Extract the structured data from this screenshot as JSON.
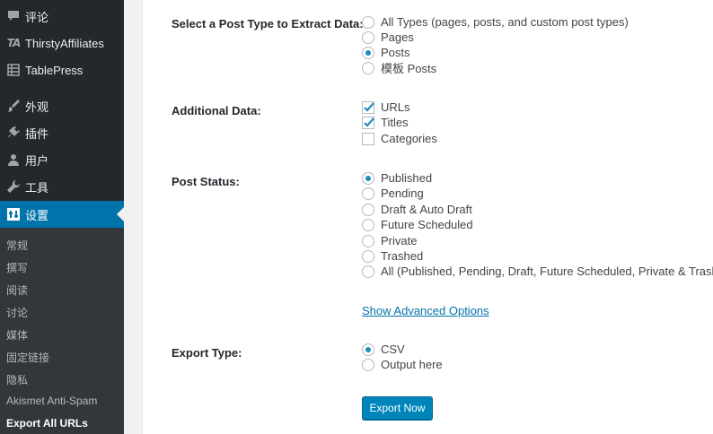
{
  "sidebar": {
    "items": [
      {
        "label": "评论",
        "icon": "comment-icon"
      },
      {
        "label": "ThirstyAffiliates",
        "icon": "thirstyaffiliates-logo-icon",
        "logo_text": "TA"
      },
      {
        "label": "TablePress",
        "icon": "table-icon"
      },
      {
        "label": "外观",
        "icon": "paintbrush-icon"
      },
      {
        "label": "插件",
        "icon": "plugin-icon"
      },
      {
        "label": "用户",
        "icon": "user-icon"
      },
      {
        "label": "工具",
        "icon": "wrench-icon"
      },
      {
        "label": "设置",
        "icon": "settings-icon",
        "active": true
      }
    ],
    "submenu": [
      {
        "label": "常规"
      },
      {
        "label": "撰写"
      },
      {
        "label": "阅读"
      },
      {
        "label": "讨论"
      },
      {
        "label": "媒体"
      },
      {
        "label": "固定链接"
      },
      {
        "label": "隐私"
      },
      {
        "label": "Akismet Anti-Spam"
      },
      {
        "label": "Export All URLs",
        "current": true
      }
    ]
  },
  "form": {
    "post_type": {
      "label": "Select a Post Type to Extract Data:",
      "options": [
        "All Types (pages, posts, and custom post types)",
        "Pages",
        "Posts",
        "模板 Posts"
      ],
      "selected": "Posts"
    },
    "additional_data": {
      "label": "Additional Data:",
      "options": [
        "URLs",
        "Titles",
        "Categories"
      ],
      "checked": [
        "URLs",
        "Titles"
      ]
    },
    "post_status": {
      "label": "Post Status:",
      "options": [
        "Published",
        "Pending",
        "Draft & Auto Draft",
        "Future Scheduled",
        "Private",
        "Trashed",
        "All (Published, Pending, Draft, Future Scheduled, Private & Trash)"
      ],
      "selected": "Published"
    },
    "advanced_link": "Show Advanced Options",
    "export_type": {
      "label": "Export Type:",
      "options": [
        "CSV",
        "Output here"
      ],
      "selected": "CSV"
    },
    "export_button": "Export Now"
  },
  "colors": {
    "sidebar_bg": "#23282d",
    "submenu_bg": "#32373c",
    "accent": "#0073aa",
    "button": "#0085ba"
  }
}
